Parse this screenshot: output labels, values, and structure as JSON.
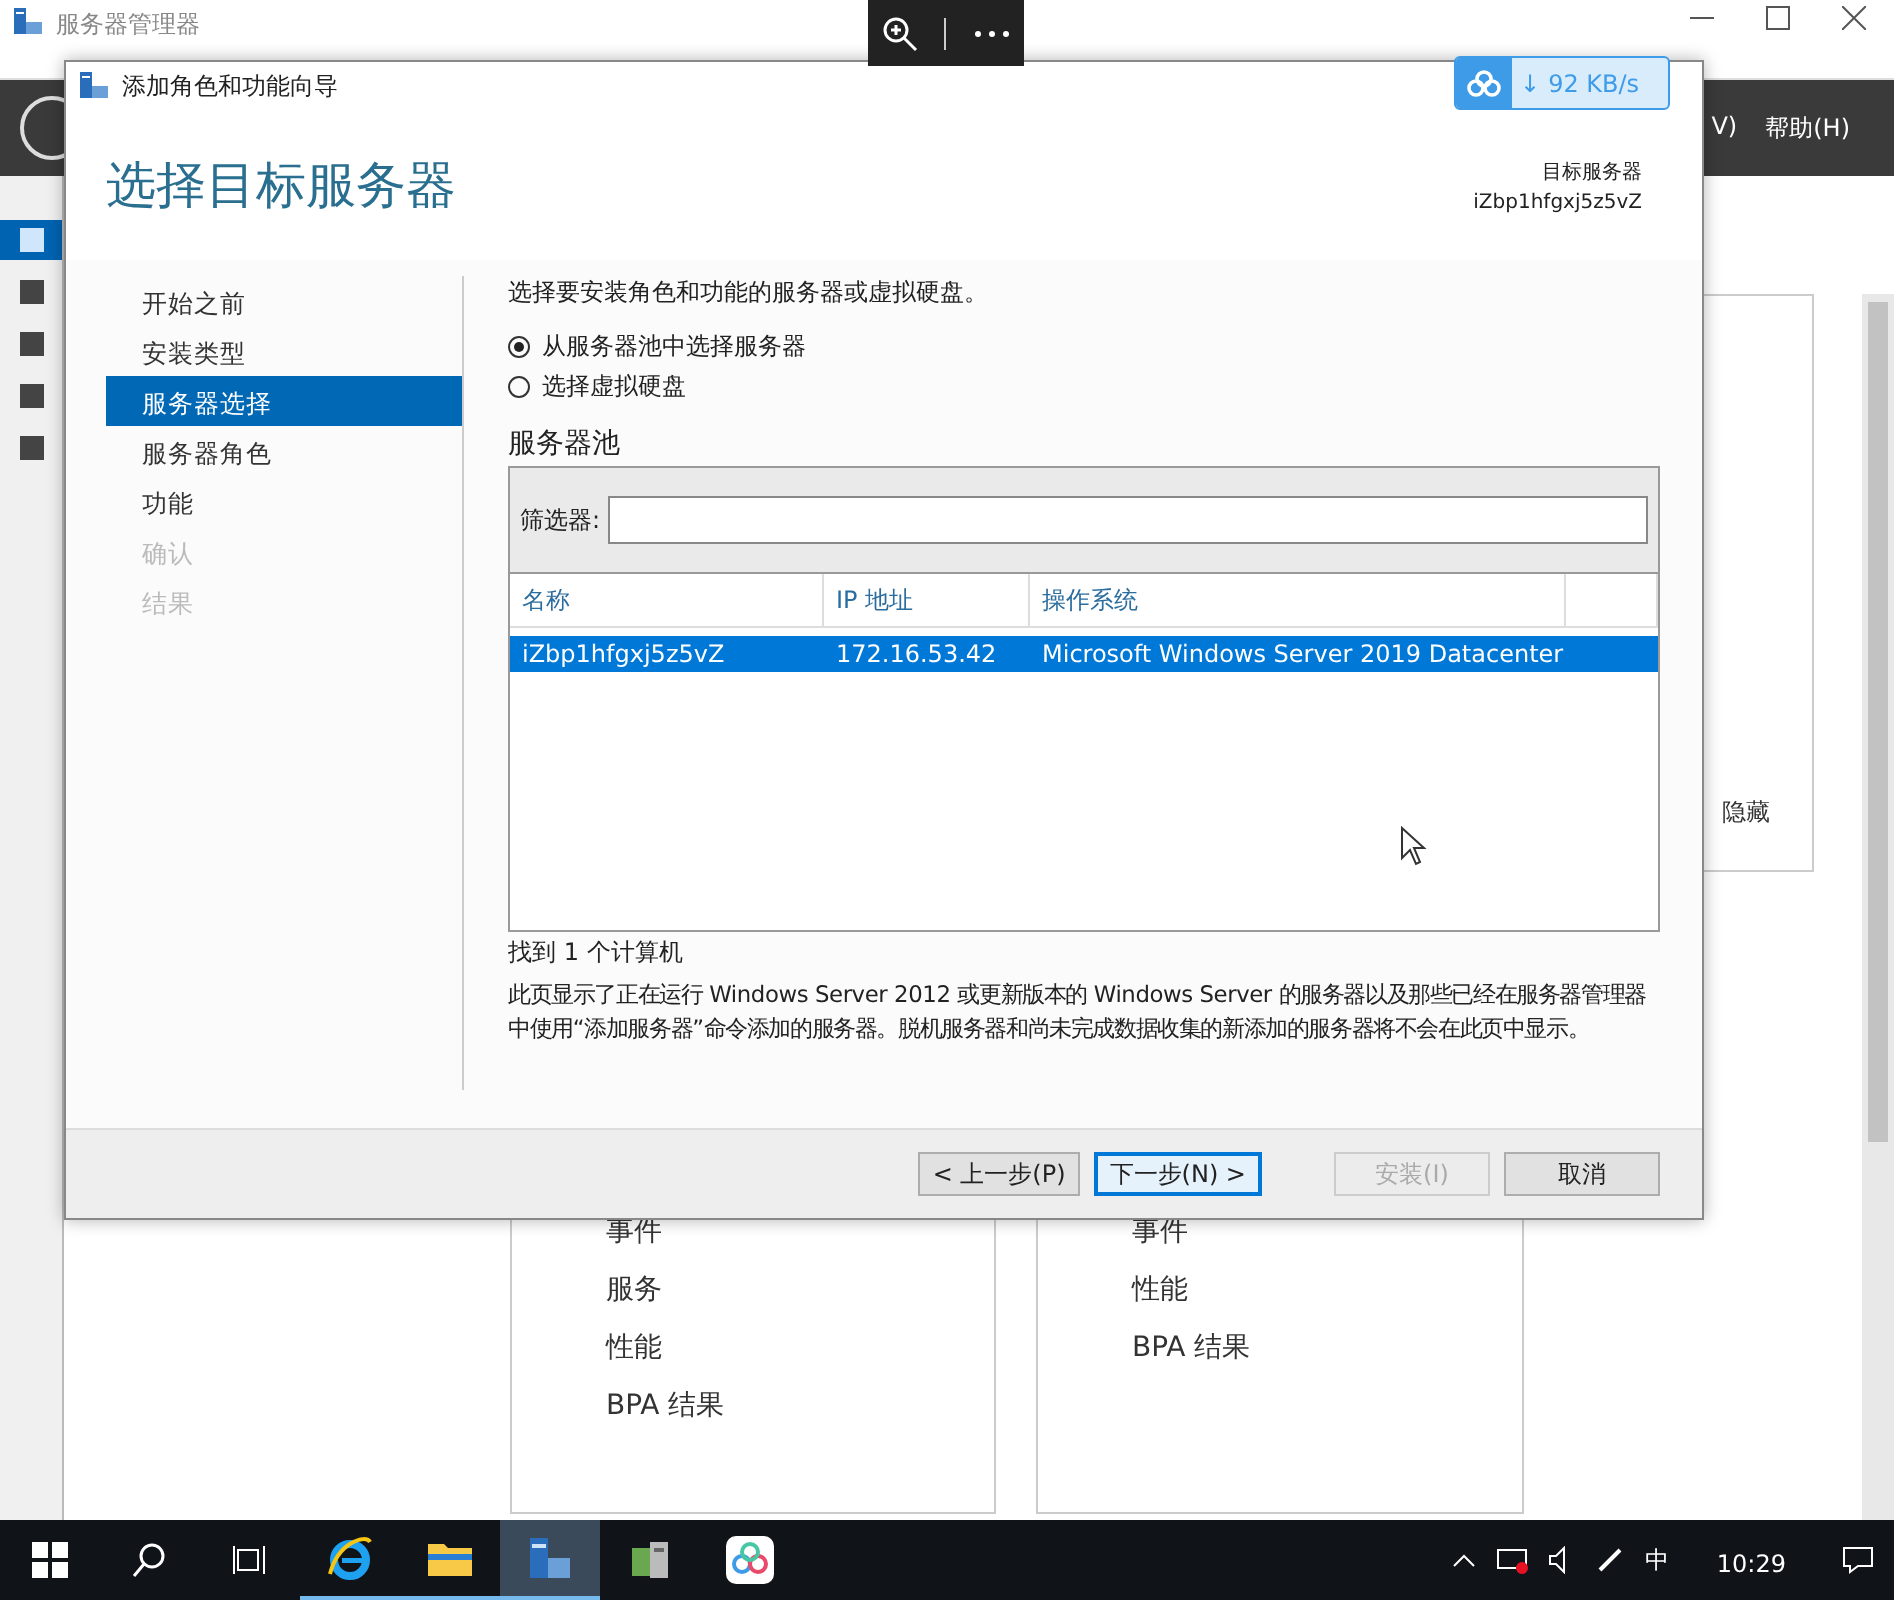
{
  "server_manager": {
    "title": "服务器管理器",
    "menu": [
      "V)",
      "帮助(H)"
    ],
    "sidebar_items": [
      {
        "selected": true
      },
      {
        "selected": false
      },
      {
        "selected": false
      },
      {
        "selected": false
      },
      {
        "selected": false
      }
    ],
    "panels": [
      {
        "items": [
          "事件",
          "服务",
          "性能",
          "BPA 结果"
        ]
      },
      {
        "items": [
          "事件",
          "性能",
          "BPA 结果"
        ]
      }
    ],
    "hide_label": "隐藏"
  },
  "speed_badge": {
    "arrow": "↓",
    "reading": "92 KB/s"
  },
  "wizard": {
    "title": "添加角色和功能向导",
    "heading": "选择目标服务器",
    "target_label": "目标服务器",
    "target_server": "iZbp1hfgxj5z5vZ",
    "steps": [
      {
        "label": "开始之前",
        "selected": false,
        "disabled": false
      },
      {
        "label": "安装类型",
        "selected": false,
        "disabled": false
      },
      {
        "label": "服务器选择",
        "selected": true,
        "disabled": false
      },
      {
        "label": "服务器角色",
        "selected": false,
        "disabled": false
      },
      {
        "label": "功能",
        "selected": false,
        "disabled": false
      },
      {
        "label": "确认",
        "selected": false,
        "disabled": true
      },
      {
        "label": "结果",
        "selected": false,
        "disabled": true
      }
    ],
    "description": "选择要安装角色和功能的服务器或虚拟硬盘。",
    "options": [
      {
        "label": "从服务器池中选择服务器",
        "selected": true
      },
      {
        "label": "选择虚拟硬盘",
        "selected": false
      }
    ],
    "pool_title": "服务器池",
    "filter_label": "筛选器:",
    "columns": [
      "名称",
      "IP 地址",
      "操作系统"
    ],
    "rows": [
      {
        "cells": [
          "iZbp1hfgxj5z5vZ",
          "172.16.53.42",
          "Microsoft Windows Server 2019 Datacenter"
        ],
        "selected": true
      }
    ],
    "found": "找到 1 个计算机",
    "note": "此页显示了正在运行 Windows Server 2012 或更新版本的 Windows Server 的服务器以及那些已经在服务器管理器中使用“添加服务器”命令添加的服务器。脱机服务器和尚未完成数据收集的新添加的服务器将不会在此页中显示。",
    "buttons": [
      {
        "label": "< 上一步(P)",
        "disabled": false,
        "focused": false
      },
      {
        "label": "下一步(N) >",
        "disabled": false,
        "focused": true
      },
      {
        "label": "安装(I)",
        "disabled": true,
        "focused": false
      },
      {
        "label": "取消",
        "disabled": false,
        "focused": false
      }
    ]
  },
  "taskbar": {
    "apps": [
      {
        "kind": "ie",
        "running": true,
        "selected": false
      },
      {
        "kind": "folder",
        "running": true,
        "selected": false
      },
      {
        "kind": "server",
        "running": true,
        "selected": true
      },
      {
        "kind": "package",
        "running": false,
        "selected": false
      },
      {
        "kind": "cloud",
        "running": false,
        "selected": false
      }
    ],
    "ime": "中",
    "clock": "10:29"
  }
}
